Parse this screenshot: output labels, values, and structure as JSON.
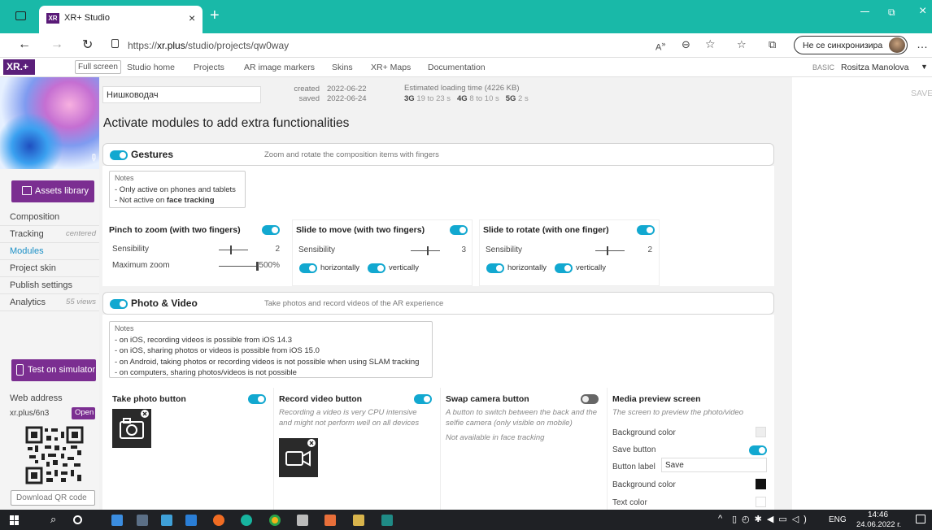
{
  "browser": {
    "tab_title": "XR+ Studio",
    "tab_favicon": "XR",
    "url_prefix": "https://",
    "url_domain": "xr.plus",
    "url_path": "/studio/projects/qw0way",
    "sync_label": "Не се синхронизира"
  },
  "appnav": {
    "logo": "XR.+",
    "fullscreen": "Full screen",
    "links": [
      "Studio home",
      "Projects",
      "AR image markers",
      "Skins",
      "XR+ Maps",
      "Documentation"
    ],
    "plan": "BASIC",
    "user": "Rositza Manolova",
    "save": "SAVE"
  },
  "sidebar": {
    "assets_button": "Assets library",
    "menu": [
      {
        "label": "Composition",
        "sub": ""
      },
      {
        "label": "Tracking",
        "sub": "centered"
      },
      {
        "label": "Modules",
        "sub": ""
      },
      {
        "label": "Project skin",
        "sub": ""
      },
      {
        "label": "Publish settings",
        "sub": ""
      },
      {
        "label": "Analytics",
        "sub": "55 views"
      }
    ],
    "test_button": "Test on simulator",
    "web_address_label": "Web address",
    "web_address": "xr.plus/6n3",
    "open_button": "Open",
    "download_qr": "Download QR code"
  },
  "project": {
    "name": "Нишководач",
    "created_label": "created",
    "created": "2022-06-22",
    "saved_label": "saved",
    "saved": "2022-06-24",
    "loading_label": "Estimated loading time (4226 KB)",
    "g3_label": "3G",
    "g3": "19 to 23 s",
    "g4_label": "4G",
    "g4": "8 to 10 s",
    "g5_label": "5G",
    "g5": "2 s"
  },
  "page_title": "Activate modules to add extra functionalities",
  "gestures": {
    "title": "Gestures",
    "description": "Zoom and rotate the composition items with fingers",
    "notes_legend": "Notes",
    "notes": [
      "- Only active on phones and tablets",
      "- Not active on "
    ],
    "notes_bold": "face tracking",
    "pinch": {
      "title": "Pinch to zoom (with two fingers)",
      "sens_label": "Sensibility",
      "sens": "2",
      "zoom_label": "Maximum zoom",
      "zoom": "500%"
    },
    "slide": {
      "title": "Slide to move (with two fingers)",
      "sens_label": "Sensibility",
      "sens": "3",
      "h": "horizontally",
      "v": "vertically"
    },
    "rotate": {
      "title": "Slide to rotate (with one finger)",
      "sens_label": "Sensibility",
      "sens": "2",
      "h": "horizontally",
      "v": "vertically"
    }
  },
  "photo": {
    "title": "Photo & Video",
    "description": "Take photos and record videos of the AR experience",
    "notes_legend": "Notes",
    "notes": [
      "- on iOS, recording videos is possible from iOS 14.3",
      "- on iOS, sharing photos or videos is possible from iOS 15.0",
      "- on Android, taking photos or recording videos is not possible when using SLAM tracking",
      "- on computers, sharing photos/videos is not possible"
    ],
    "take_photo": "Take photo button",
    "record_video": "Record video button",
    "record_note": "Recording a video is very CPU intensive and might not perform well on all devices",
    "swap_camera": "Swap camera button",
    "swap_note": "A button to switch between the back and the selfie camera (only visible on mobile)",
    "swap_note2": "Not available in face tracking",
    "media_preview": "Media preview screen",
    "media_note": "The screen to preview the photo/video",
    "bg_color": "Background color",
    "save_button": "Save button",
    "button_label": "Button label",
    "button_label_value": "Save",
    "bg_color2": "Background color",
    "text_color": "Text color"
  },
  "taskbar": {
    "lang": "ENG",
    "time": "14:46",
    "date": "24.06.2022 г."
  },
  "colors": {
    "teal": "#19b9a8",
    "toggle": "#12a8d0",
    "purple": "#7b2e91"
  }
}
